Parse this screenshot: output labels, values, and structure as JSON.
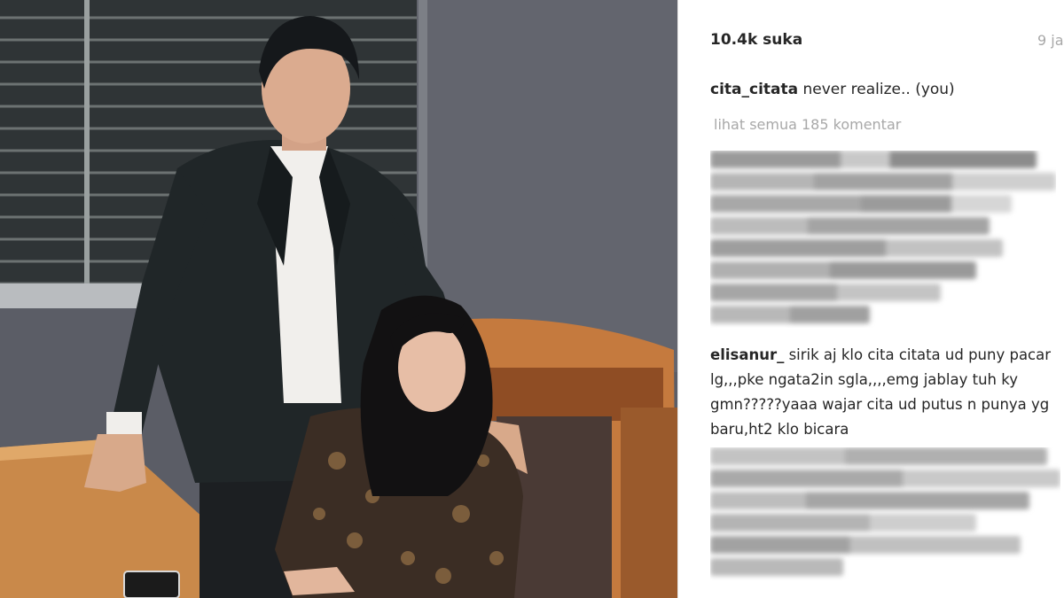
{
  "photo": {
    "alt_subject": "man in dark suit standing beside seated woman in patterned dress at office table"
  },
  "post": {
    "likes": "10.4k suka",
    "date": "9 ja",
    "caption_user": "cita_citata",
    "caption_text": " never realize.. (you)",
    "view_all": "lihat semua 185 komentar"
  },
  "comments": [
    {
      "user": "elisanur_",
      "text": " sirik aj klo cita citata ud puny pacar lg,,,pke ngata2in sgla,,,,emg jablay tuh ky gmn?????yaaa wajar cita ud putus n punya yg baru,ht2 klo bicara"
    }
  ],
  "colors": {
    "text": "#262626",
    "muted": "#a8a8a8",
    "wall": "#5d5f68",
    "table": "#c9894a"
  }
}
